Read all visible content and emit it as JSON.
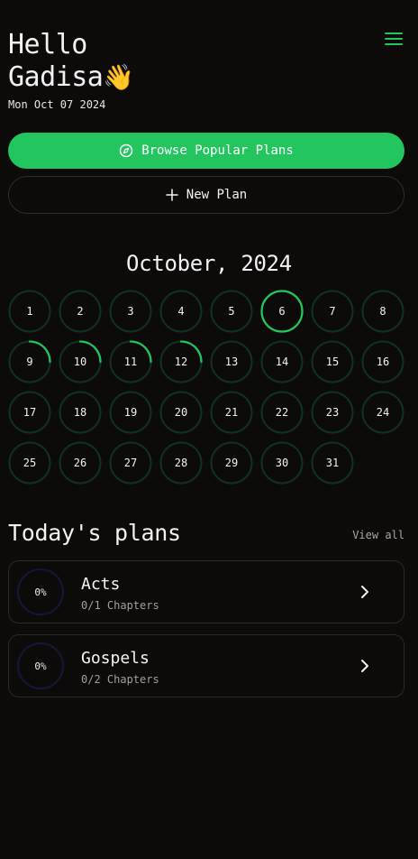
{
  "header": {
    "greeting_line1": "Hello",
    "greeting_line2": "Gadisa",
    "wave_emoji": "👋",
    "date": "Mon Oct 07 2024",
    "menu_icon": "hamburger-menu-icon"
  },
  "actions": {
    "browse_label": "Browse Popular Plans",
    "browse_icon": "compass-icon",
    "new_plan_label": "New Plan",
    "new_plan_icon": "plus-icon"
  },
  "calendar": {
    "month_title": "October, 2024",
    "today": 6,
    "days": [
      {
        "day": "1",
        "progress": 0
      },
      {
        "day": "2",
        "progress": 0
      },
      {
        "day": "3",
        "progress": 0
      },
      {
        "day": "4",
        "progress": 0
      },
      {
        "day": "5",
        "progress": 0
      },
      {
        "day": "6",
        "progress": 1
      },
      {
        "day": "7",
        "progress": 0
      },
      {
        "day": "8",
        "progress": 0
      },
      {
        "day": "9",
        "progress": 0.25
      },
      {
        "day": "10",
        "progress": 0.25
      },
      {
        "day": "11",
        "progress": 0.25
      },
      {
        "day": "12",
        "progress": 0.25
      },
      {
        "day": "13",
        "progress": 0
      },
      {
        "day": "14",
        "progress": 0
      },
      {
        "day": "15",
        "progress": 0
      },
      {
        "day": "16",
        "progress": 0
      },
      {
        "day": "17",
        "progress": 0
      },
      {
        "day": "18",
        "progress": 0
      },
      {
        "day": "19",
        "progress": 0
      },
      {
        "day": "20",
        "progress": 0
      },
      {
        "day": "21",
        "progress": 0
      },
      {
        "day": "22",
        "progress": 0
      },
      {
        "day": "23",
        "progress": 0
      },
      {
        "day": "24",
        "progress": 0
      },
      {
        "day": "25",
        "progress": 0
      },
      {
        "day": "26",
        "progress": 0
      },
      {
        "day": "27",
        "progress": 0
      },
      {
        "day": "28",
        "progress": 0
      },
      {
        "day": "29",
        "progress": 0
      },
      {
        "day": "30",
        "progress": 0
      },
      {
        "day": "31",
        "progress": 0
      }
    ]
  },
  "plans_section": {
    "title": "Today's plans",
    "view_all": "View all",
    "plans": [
      {
        "name": "Acts",
        "progress_label": "0%",
        "chapters": "0/1 Chapters"
      },
      {
        "name": "Gospels",
        "progress_label": "0%",
        "chapters": "0/2 Chapters"
      }
    ]
  },
  "colors": {
    "accent": "#22c55e",
    "ring_track": "#0f3320",
    "plan_ring": "#16163a",
    "background": "#0d0b0a"
  }
}
